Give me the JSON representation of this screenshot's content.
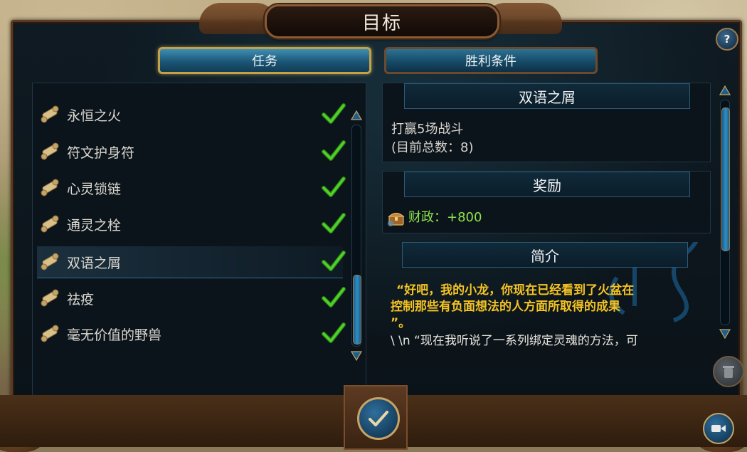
{
  "window": {
    "title": "目标"
  },
  "tabs": [
    {
      "label": "任务",
      "active": true
    },
    {
      "label": "胜利条件",
      "active": false
    }
  ],
  "quests": [
    {
      "label": "永恒之火",
      "completed": true,
      "selected": false
    },
    {
      "label": "符文护身符",
      "completed": true,
      "selected": false
    },
    {
      "label": "心灵锁链",
      "completed": true,
      "selected": false
    },
    {
      "label": "通灵之栓",
      "completed": true,
      "selected": false
    },
    {
      "label": "双语之屑",
      "completed": true,
      "selected": true
    },
    {
      "label": "祛疫",
      "completed": true,
      "selected": false
    },
    {
      "label": "毫无价值的野兽",
      "completed": true,
      "selected": false
    }
  ],
  "detail": {
    "title": "双语之屑",
    "objective_line1": "打赢5场战斗",
    "objective_line2": "(目前总数：8)",
    "rewards_header": "奖励",
    "reward_text": "财政：+800",
    "description_header": "简介",
    "description_quote_line1": "“好吧，我的小龙，你现在已经看到了火盆在",
    "description_quote_line2": "控制那些有负面想法的人方面所取得的成果",
    "description_quote_line3": "”。",
    "description_next_line": "\\ \\n “现在我听说了一系列绑定灵魂的方法，可"
  },
  "icons": {
    "quest": "scroll-icon",
    "completed": "checkmark-icon",
    "reward": "treasure-chest-icon",
    "help": "help-icon",
    "confirm": "checkmark-icon",
    "trash": "trash-icon",
    "video": "video-camera-icon"
  },
  "buttons": {
    "help_label": "?"
  },
  "colors": {
    "accent_gold": "#c4a24a",
    "check_green": "#4fd12a",
    "reward_green": "#8ee34d",
    "quote_yellow": "#f4c323"
  }
}
